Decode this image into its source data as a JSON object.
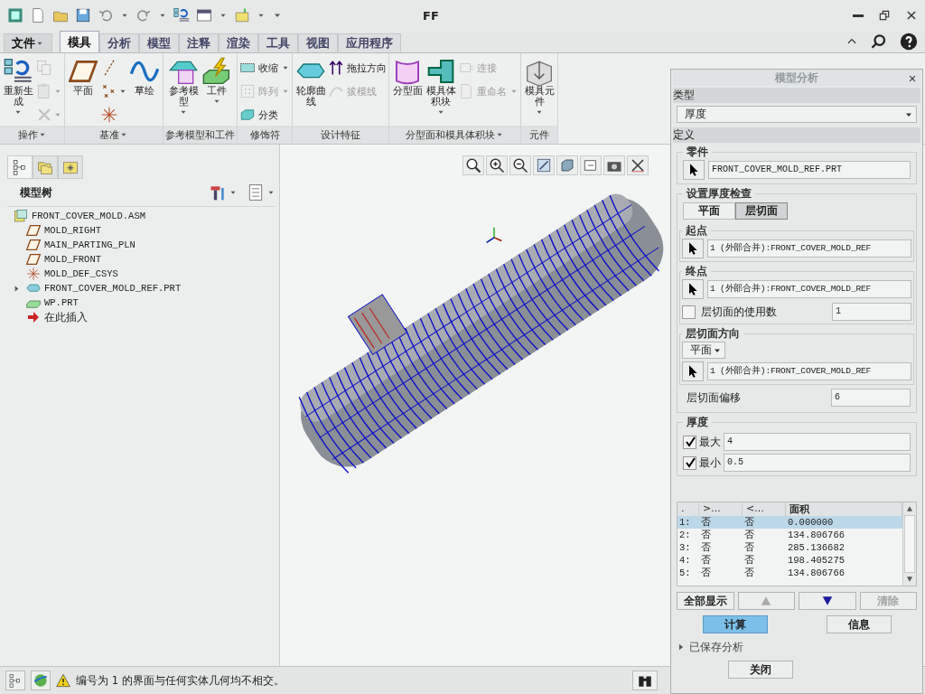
{
  "window": {
    "title": "FF"
  },
  "menu_tabs": [
    {
      "label": "文件",
      "dropdown": true,
      "selected": false
    },
    {
      "label": "模具",
      "dropdown": false,
      "selected": true
    },
    {
      "label": "分析",
      "dropdown": false,
      "selected": false
    },
    {
      "label": "模型",
      "dropdown": false,
      "selected": false
    },
    {
      "label": "注释",
      "dropdown": false,
      "selected": false
    },
    {
      "label": "渲染",
      "dropdown": false,
      "selected": false
    },
    {
      "label": "工具",
      "dropdown": false,
      "selected": false
    },
    {
      "label": "视图",
      "dropdown": false,
      "selected": false
    },
    {
      "label": "应用程序",
      "dropdown": false,
      "selected": false
    }
  ],
  "ribbon_groups": [
    {
      "label": "操作",
      "dropdown": true,
      "columns": [
        {
          "kind": "large",
          "label": "重新生成",
          "dropdown": true,
          "disabled": false
        },
        {
          "kind": "icons",
          "items": [
            {
              "disabled": true,
              "dropdown": false
            },
            {
              "disabled": true,
              "dropdown": true
            },
            {
              "disabled": true,
              "dropdown": true
            }
          ]
        }
      ]
    },
    {
      "label": "基准",
      "dropdown": true,
      "columns": [
        {
          "kind": "large",
          "label": "平面",
          "dropdown": false,
          "disabled": false
        },
        {
          "kind": "icons",
          "items": [
            {
              "disabled": false,
              "dropdown": false
            },
            {
              "disabled": false,
              "dropdown": true
            },
            {
              "disabled": false,
              "dropdown": false
            }
          ]
        },
        {
          "kind": "large",
          "label": "草绘",
          "dropdown": false,
          "disabled": false
        }
      ]
    },
    {
      "label": "参考模型和工件",
      "dropdown": false,
      "columns": [
        {
          "kind": "large",
          "label": "参考模型",
          "dropdown": true,
          "disabled": false
        },
        {
          "kind": "large",
          "label": "工件",
          "dropdown": true,
          "disabled": false
        }
      ]
    },
    {
      "label": "修饰符",
      "dropdown": false,
      "columns": [
        {
          "kind": "smalls",
          "items": [
            {
              "label": "收缩",
              "dropdown": true,
              "disabled": false
            },
            {
              "label": "阵列",
              "dropdown": true,
              "disabled": true
            },
            {
              "label": "分类",
              "dropdown": false,
              "disabled": false
            }
          ]
        }
      ]
    },
    {
      "label": "设计特征",
      "dropdown": false,
      "columns": [
        {
          "kind": "large",
          "label": "轮廓曲线",
          "dropdown": false,
          "disabled": false
        },
        {
          "kind": "smalls",
          "items": [
            {
              "label": "拖拉方向",
              "dropdown": false,
              "disabled": false
            },
            {
              "label": "拔模线",
              "dropdown": false,
              "disabled": true
            }
          ]
        }
      ]
    },
    {
      "label": "分型面和模具体积块",
      "dropdown": true,
      "columns": [
        {
          "kind": "large",
          "label": "分型面",
          "dropdown": false,
          "disabled": false
        },
        {
          "kind": "large",
          "label": "模具体积块",
          "dropdown": true,
          "disabled": false
        },
        {
          "kind": "smalls",
          "items": [
            {
              "label": "连接",
              "dropdown": false,
              "disabled": true
            },
            {
              "label": "重命名",
              "dropdown": true,
              "disabled": true
            }
          ]
        }
      ]
    },
    {
      "label": "元件",
      "dropdown": false,
      "columns": [
        {
          "kind": "large",
          "label": "模具元件",
          "dropdown": true,
          "disabled": false
        }
      ]
    }
  ],
  "model_tree": {
    "title": "模型树",
    "tabs": [
      {
        "selected": true
      },
      {
        "selected": false
      },
      {
        "selected": false
      }
    ],
    "items": [
      {
        "kind": "assembly",
        "label": "FRONT_COVER_MOLD.ASM",
        "children": [
          {
            "kind": "datum_plane",
            "label": "MOLD_RIGHT"
          },
          {
            "kind": "datum_plane",
            "label": "MAIN_PARTING_PLN"
          },
          {
            "kind": "datum_plane",
            "label": "MOLD_FRONT"
          },
          {
            "kind": "csys",
            "label": "MOLD_DEF_CSYS"
          },
          {
            "kind": "part",
            "label": "FRONT_COVER_MOLD_REF.PRT",
            "expanded": false
          },
          {
            "kind": "workpiece",
            "label": "WP.PRT"
          },
          {
            "kind": "insert",
            "label": "在此插入"
          }
        ]
      }
    ]
  },
  "dialog": {
    "title": "模型分析",
    "type_label": "类型",
    "type_value": "厚度",
    "definition_label": "定义",
    "part_group": {
      "label": "零件",
      "value": "FRONT_COVER_MOLD_REF.PRT"
    },
    "check_group": {
      "label": "设置厚度检查",
      "modes": [
        {
          "label": "平面",
          "selected": false
        },
        {
          "label": "层切面",
          "selected": true
        }
      ],
      "start": {
        "label": "起点",
        "value": "1 (外部合并):FRONT_COVER_MOLD_REF"
      },
      "end": {
        "label": "终点",
        "value": "1 (外部合并):FRONT_COVER_MOLD_REF",
        "count_label": "层切面的使用数",
        "count_checked": false,
        "count_value": "1"
      },
      "direction": {
        "label": "层切面方向",
        "option": "平面",
        "value": "1 (外部合并):FRONT_COVER_MOLD_REF"
      },
      "offset_label": "层切面偏移",
      "offset_value": "6"
    },
    "thickness_group": {
      "label": "厚度",
      "rows": [
        {
          "label": "最大",
          "checked": true,
          "value": "4"
        },
        {
          "label": "最小",
          "checked": true,
          "value": "0.5"
        }
      ]
    },
    "table": {
      "columns": [
        ".",
        ">...",
        "<...",
        "面积"
      ],
      "rows": [
        {
          "cells": [
            "1:",
            "否",
            "否",
            "0.000000"
          ],
          "selected": true
        },
        {
          "cells": [
            "2:",
            "否",
            "否",
            "134.806766"
          ],
          "selected": false
        },
        {
          "cells": [
            "3:",
            "否",
            "否",
            "285.136682"
          ],
          "selected": false
        },
        {
          "cells": [
            "4:",
            "否",
            "否",
            "198.405275"
          ],
          "selected": false
        },
        {
          "cells": [
            "5:",
            "否",
            "否",
            "134.806766"
          ],
          "selected": false
        }
      ]
    },
    "list_buttons": [
      {
        "kind": "text",
        "label": "全部显示",
        "disabled": false
      },
      {
        "kind": "up",
        "disabled": true
      },
      {
        "kind": "down",
        "disabled": false
      },
      {
        "kind": "text",
        "label": "清除",
        "disabled": true
      }
    ],
    "actions": [
      {
        "label": "计算",
        "primary": true
      },
      {
        "label": "信息",
        "primary": false
      }
    ],
    "saved": {
      "label": "已保存分析",
      "expanded": false
    },
    "close_label": "关闭"
  },
  "status_bar": {
    "message": "编号为 1 的界面与任何实体几何均不相交。"
  }
}
